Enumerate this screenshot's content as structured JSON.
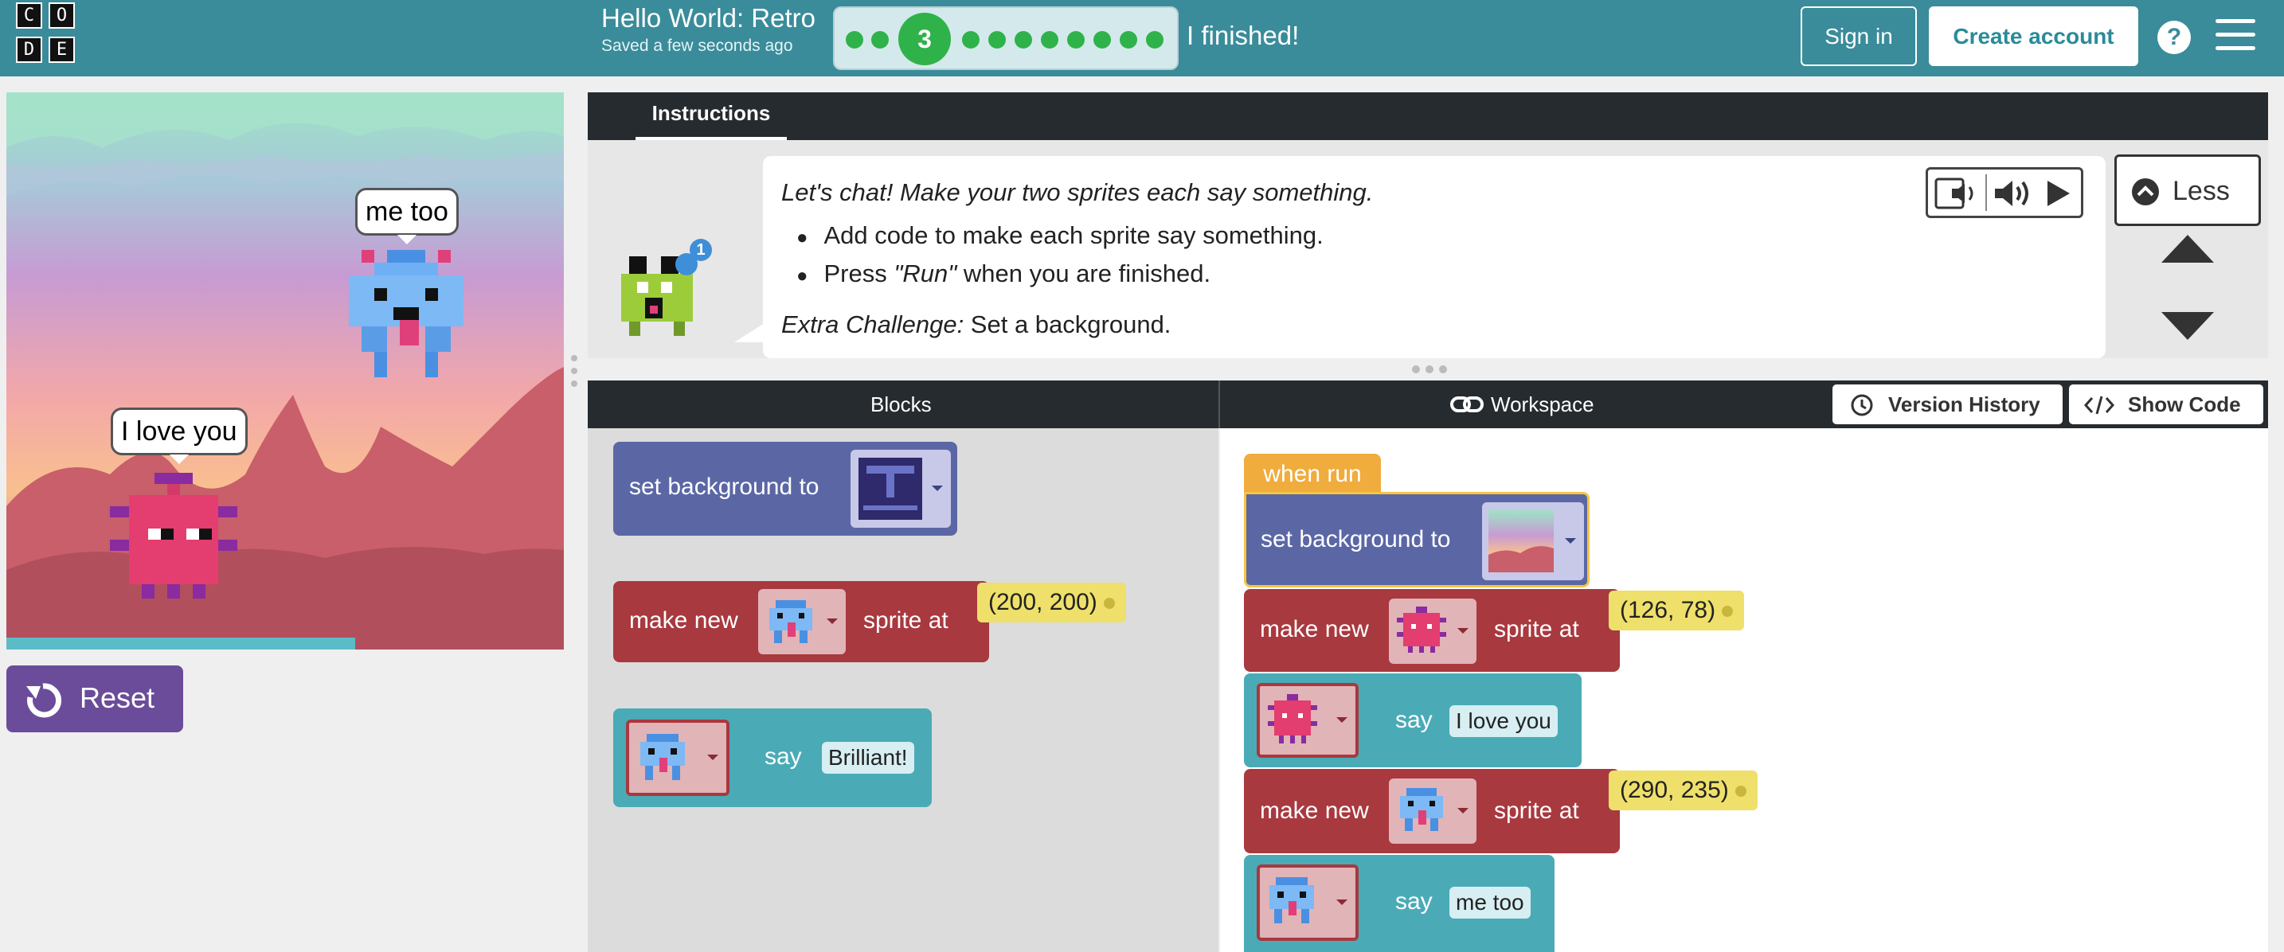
{
  "header": {
    "logo_letters": [
      "C",
      "O",
      "D",
      "E"
    ],
    "title": "Hello World: Retro",
    "saved_status": "Saved a few seconds ago",
    "current_level": "3",
    "finished_label": "I finished!",
    "sign_in_label": "Sign in",
    "create_account_label": "Create account",
    "help_label": "?"
  },
  "stage": {
    "bubble_top": "me too",
    "bubble_bottom": "I love you",
    "reset_label": "Reset"
  },
  "instructions": {
    "tab_label": "Instructions",
    "heading": "Let's chat! Make your two sprites each say something.",
    "bullet1": "Add code to make each sprite say something.",
    "bullet2_pre": "Press ",
    "bullet2_em": "\"Run\"",
    "bullet2_post": " when you are finished.",
    "extra_label": "Extra Challenge:",
    "extra_text": " Set a background.",
    "badge_count": "1",
    "less_label": "Less"
  },
  "workspace_header": {
    "blocks_label": "Blocks",
    "workspace_label": "Workspace",
    "version_history_label": "Version History",
    "show_code_label": "Show Code"
  },
  "toolbox": {
    "bg_label": "set background to",
    "make_new_label": "make new",
    "sprite_at_label": "sprite at",
    "sprite_pos": "(200, 200)",
    "say_label": "say",
    "say_text": "Brilliant!"
  },
  "program": {
    "hat_label": "when run",
    "bg_label": "set background to",
    "make_new_label": "make new",
    "sprite_at_label": "sprite at",
    "say_label": "say",
    "pos1": "(126, 78)",
    "say1": "I love you",
    "pos2": "(290, 235)",
    "say2": "me too"
  },
  "colors": {
    "header": "#3a8c9a",
    "progress_green": "#2fb24a",
    "block_purple": "#5b67a5",
    "block_red": "#a8393f",
    "block_teal": "#4aabb7",
    "hat_orange": "#f0ac3c",
    "value_yellow": "#eee06b",
    "reset_purple": "#6b4c9a"
  }
}
